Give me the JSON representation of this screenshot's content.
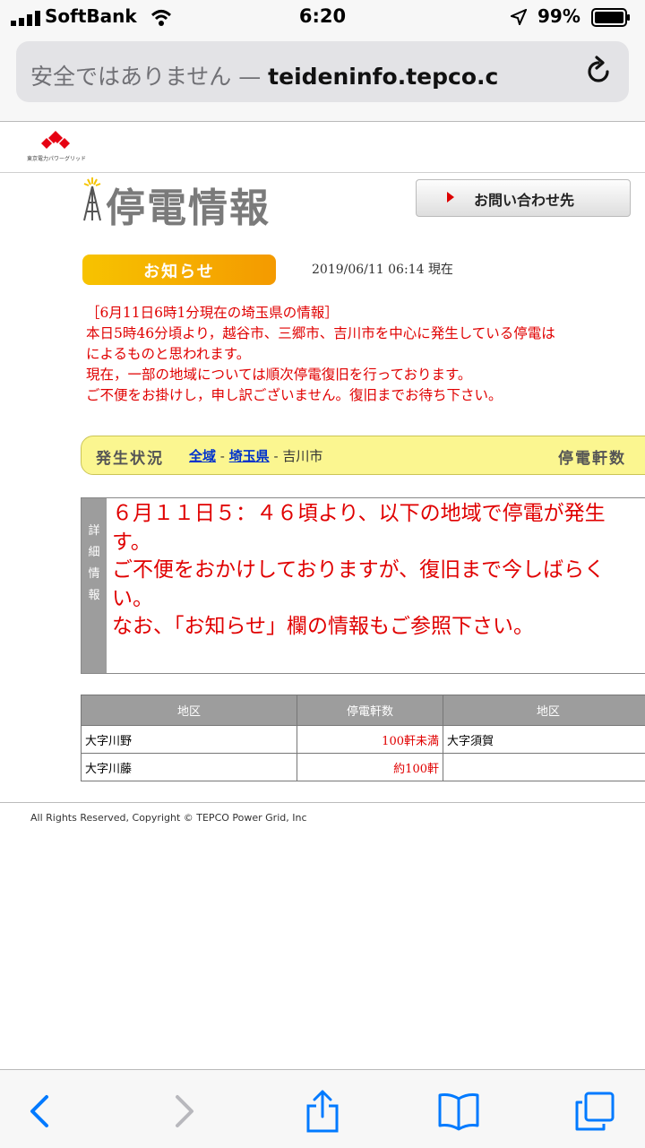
{
  "status_bar": {
    "carrier": "SoftBank",
    "time": "6:20",
    "battery": "99%"
  },
  "address_bar": {
    "insecure_label": "安全ではありません —",
    "domain": "teideninfo.tepco.c"
  },
  "header": {
    "logo_text": "東京電力パワーグリッド",
    "page_title": "停電情報",
    "contact_button": "お問い合わせ先"
  },
  "notice": {
    "badge": "お知らせ",
    "timestamp": "2019/06/11 06:14 現在",
    "lines": [
      "［6月11日6時1分現在の埼玉県の情報］",
      "本日5時46分頃より，越谷市、三郷市、吉川市を中心に発生している停電は",
      "によるものと思われます。",
      "現在，一部の地域については順次停電復旧を行っております。",
      "ご不便をお掛けし，申し訳ございません。復旧までお待ち下さい。"
    ]
  },
  "status": {
    "label": "発生状況",
    "crumb_all": "全域",
    "crumb_pref": "埼玉県",
    "sep": "-",
    "crumb_city": "吉川市",
    "right_label": "停電軒数"
  },
  "detail": {
    "side_chars": [
      "詳",
      "細",
      "情",
      "報"
    ],
    "lines": [
      "６月１１日５：４６頃より、以下の地域で停電が発生",
      "す。",
      "ご不便をおかけしておりますが、復旧まで今しばらく",
      "い。",
      "なお、「お知らせ」欄の情報もご参照下さい。"
    ]
  },
  "table": {
    "headers": [
      "地区",
      "停電軒数",
      "地区"
    ],
    "rows": [
      [
        "大字川野",
        "100軒未満",
        "大字須賀"
      ],
      [
        "大字川藤",
        "約100軒",
        ""
      ]
    ]
  },
  "footer": {
    "copyright": "All Rights Reserved, Copyright © TEPCO Power Grid, Inc"
  },
  "toolbar": {
    "icons": [
      "back-icon",
      "forward-icon",
      "share-icon",
      "bookmarks-icon",
      "tabs-icon"
    ]
  },
  "colors": {
    "accent_blue": "#007aff",
    "notice_red": "#e00000",
    "badge_orange": "#f49a00",
    "status_yellow": "#fbf690"
  }
}
